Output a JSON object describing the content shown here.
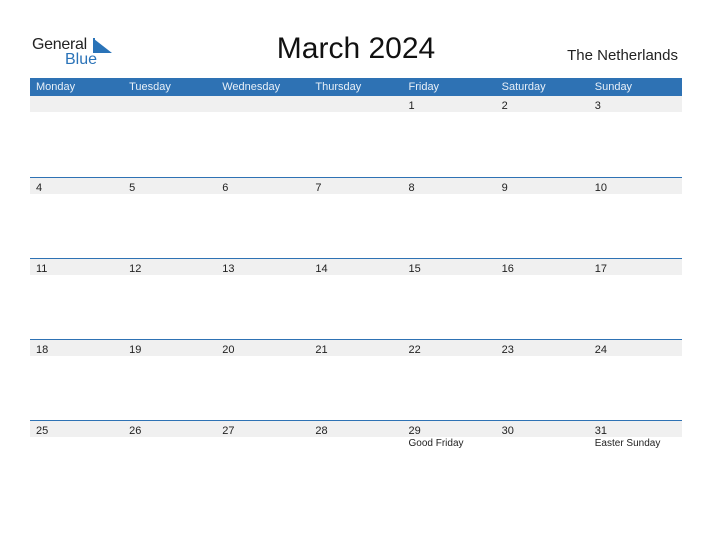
{
  "logo": {
    "line1": "General",
    "line2": "Blue"
  },
  "title": "March 2024",
  "country": "The Netherlands",
  "colors": {
    "accent": "#2e72b4",
    "daybar": "#f0f0f0"
  },
  "weekdays": [
    "Monday",
    "Tuesday",
    "Wednesday",
    "Thursday",
    "Friday",
    "Saturday",
    "Sunday"
  ],
  "weeks": [
    [
      {
        "day": ""
      },
      {
        "day": ""
      },
      {
        "day": ""
      },
      {
        "day": ""
      },
      {
        "day": "1"
      },
      {
        "day": "2"
      },
      {
        "day": "3"
      }
    ],
    [
      {
        "day": "4"
      },
      {
        "day": "5"
      },
      {
        "day": "6"
      },
      {
        "day": "7"
      },
      {
        "day": "8"
      },
      {
        "day": "9"
      },
      {
        "day": "10"
      }
    ],
    [
      {
        "day": "11"
      },
      {
        "day": "12"
      },
      {
        "day": "13"
      },
      {
        "day": "14"
      },
      {
        "day": "15"
      },
      {
        "day": "16"
      },
      {
        "day": "17"
      }
    ],
    [
      {
        "day": "18"
      },
      {
        "day": "19"
      },
      {
        "day": "20"
      },
      {
        "day": "21"
      },
      {
        "day": "22"
      },
      {
        "day": "23"
      },
      {
        "day": "24"
      }
    ],
    [
      {
        "day": "25"
      },
      {
        "day": "26"
      },
      {
        "day": "27"
      },
      {
        "day": "28"
      },
      {
        "day": "29",
        "holiday": "Good Friday"
      },
      {
        "day": "30"
      },
      {
        "day": "31",
        "holiday": "Easter Sunday"
      }
    ]
  ]
}
